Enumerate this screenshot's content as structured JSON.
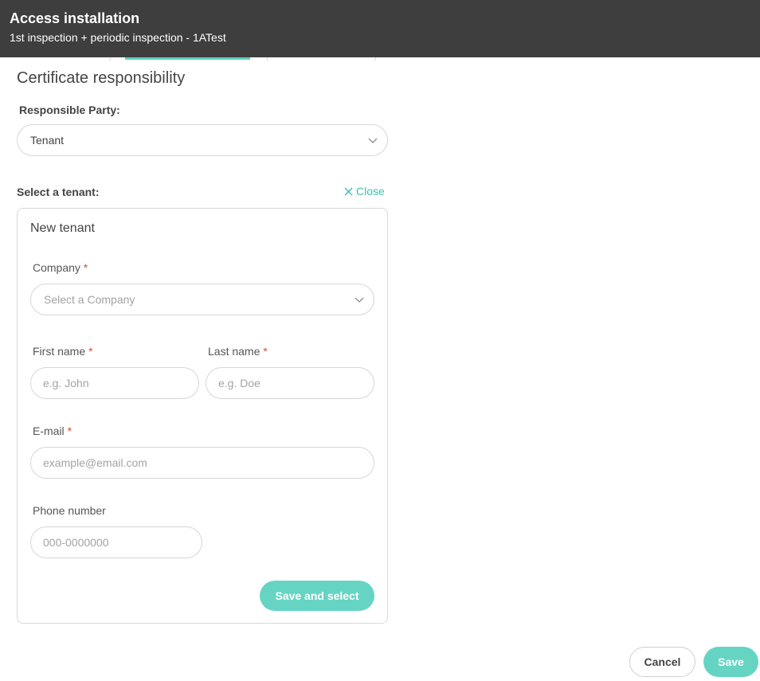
{
  "header": {
    "title": "Access installation",
    "subtitle": "1st inspection + periodic inspection - 1ATest"
  },
  "section": {
    "title": "Certificate responsibility"
  },
  "responsible_party": {
    "label": "Responsible Party:",
    "value": "Tenant"
  },
  "tenant_select": {
    "label": "Select a tenant:",
    "close_label": "Close"
  },
  "new_tenant": {
    "title": "New tenant",
    "company": {
      "label": "Company",
      "required": "*",
      "placeholder": "Select a Company"
    },
    "first_name": {
      "label": "First name",
      "required": "*",
      "placeholder": "e.g. John"
    },
    "last_name": {
      "label": "Last name",
      "required": "*",
      "placeholder": "e.g. Doe"
    },
    "email": {
      "label": "E-mail",
      "required": "*",
      "placeholder": "example@email.com"
    },
    "phone": {
      "label": "Phone number",
      "placeholder": "000-0000000"
    },
    "save_select_label": "Save and select"
  },
  "footer": {
    "cancel_label": "Cancel",
    "save_label": "Save"
  },
  "colors": {
    "header_bg": "#3e3e3e",
    "accent": "#66d4c3",
    "accent_text": "#3cc2ae",
    "required": "#e2453c"
  },
  "icons": {
    "close": "close-x-icon",
    "dropdown": "chevron-down-icon"
  }
}
